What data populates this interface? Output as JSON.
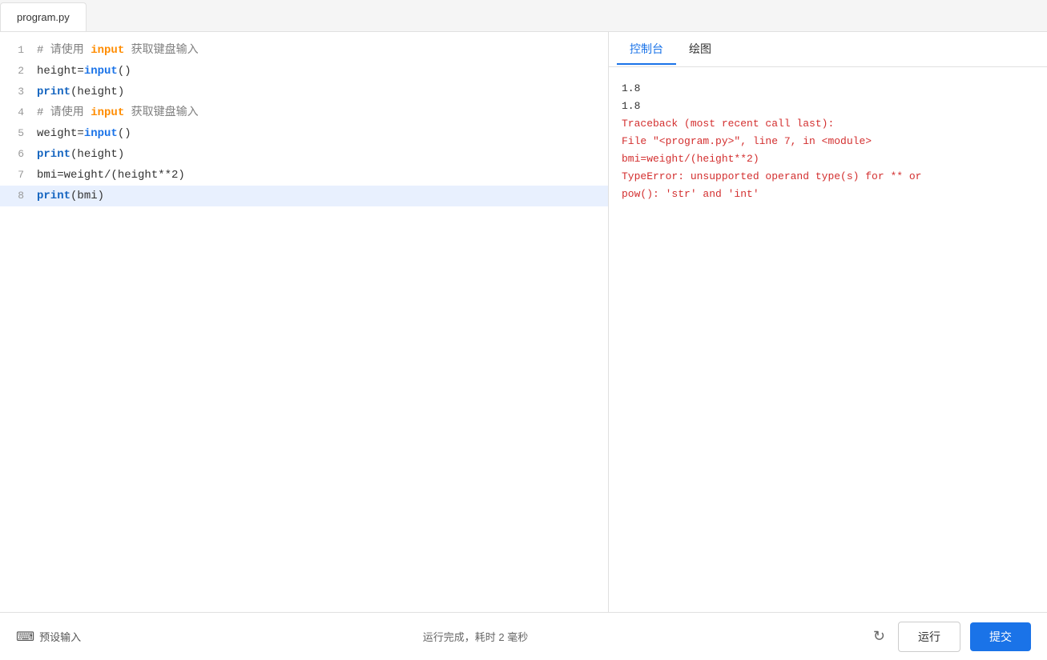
{
  "tab": {
    "filename": "program.py"
  },
  "editor": {
    "lines": [
      {
        "number": 1,
        "highlighted": false,
        "parts": [
          {
            "text": "# 请使用 ",
            "class": "kw-comment"
          },
          {
            "text": "input",
            "class": "kw-hint"
          },
          {
            "text": " 获取键盘输入",
            "class": "kw-comment"
          }
        ]
      },
      {
        "number": 2,
        "highlighted": false,
        "parts": [
          {
            "text": "height=",
            "class": "kw-plain"
          },
          {
            "text": "input",
            "class": "kw-input"
          },
          {
            "text": "()",
            "class": "kw-plain"
          }
        ]
      },
      {
        "number": 3,
        "highlighted": false,
        "parts": [
          {
            "text": "print",
            "class": "kw-print"
          },
          {
            "text": "(height)",
            "class": "kw-plain"
          }
        ]
      },
      {
        "number": 4,
        "highlighted": false,
        "parts": [
          {
            "text": "# 请使用 ",
            "class": "kw-comment"
          },
          {
            "text": "input",
            "class": "kw-hint"
          },
          {
            "text": " 获取键盘输入",
            "class": "kw-comment"
          }
        ]
      },
      {
        "number": 5,
        "highlighted": false,
        "parts": [
          {
            "text": "weight=",
            "class": "kw-plain"
          },
          {
            "text": "input",
            "class": "kw-input"
          },
          {
            "text": "()",
            "class": "kw-plain"
          }
        ]
      },
      {
        "number": 6,
        "highlighted": false,
        "parts": [
          {
            "text": "print",
            "class": "kw-print"
          },
          {
            "text": "(height)",
            "class": "kw-plain"
          }
        ]
      },
      {
        "number": 7,
        "highlighted": false,
        "parts": [
          {
            "text": "bmi=weight/(height**2)",
            "class": "kw-plain"
          }
        ]
      },
      {
        "number": 8,
        "highlighted": true,
        "parts": [
          {
            "text": "print",
            "class": "kw-print"
          },
          {
            "text": "(bmi)",
            "class": "kw-plain"
          }
        ]
      }
    ]
  },
  "right_panel": {
    "tabs": [
      {
        "label": "控制台",
        "active": true
      },
      {
        "label": "绘图",
        "active": false
      }
    ],
    "console_output": [
      {
        "text": "1.8",
        "class": "console-plain"
      },
      {
        "text": "1.8",
        "class": "console-plain"
      },
      {
        "text": "Traceback (most recent call last):",
        "class": "console-error"
      },
      {
        "text": "  File \"<program.py>\", line 7, in <module>",
        "class": "console-error"
      },
      {
        "text": "    bmi=weight/(height**2)",
        "class": "console-error"
      },
      {
        "text": "TypeError: unsupported operand type(s) for ** or",
        "class": "console-error"
      },
      {
        "text": "pow(): 'str' and 'int'",
        "class": "console-error"
      }
    ]
  },
  "toolbar": {
    "preset_label": "预设输入",
    "status_text": "运行完成，耗时 2 毫秒",
    "run_label": "运行",
    "submit_label": "提交"
  }
}
